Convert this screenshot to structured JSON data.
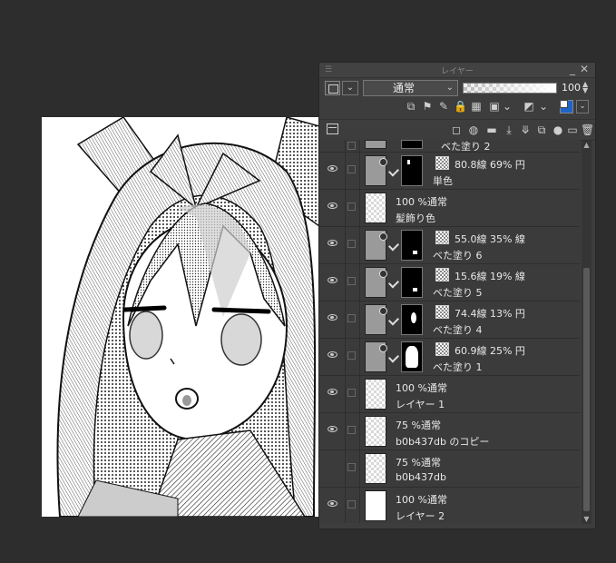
{
  "panel": {
    "title": "レイヤー",
    "blend_mode": "通常",
    "opacity": "100",
    "blend_arrow": "⌄"
  },
  "layers": [
    {
      "name": "ベた塗り 2",
      "info": "",
      "visible": false,
      "type": "partial"
    },
    {
      "name": "単色",
      "info": "80.8線 69% 円",
      "visible": true,
      "type": "tone",
      "mask_shape": "small"
    },
    {
      "name": "髪飾り色",
      "info": "100 %通常",
      "visible": true,
      "type": "raster"
    },
    {
      "name": "ベた塗り 6",
      "info": "55.0線 35% 線",
      "visible": true,
      "type": "tone",
      "mask_shape": "dot"
    },
    {
      "name": "ベた塗り 5",
      "info": "15.6線 19% 線",
      "visible": true,
      "type": "tone",
      "mask_shape": "dot"
    },
    {
      "name": "ベた塗り 4",
      "info": "74.4線 13% 円",
      "visible": true,
      "type": "tone",
      "mask_shape": "blob"
    },
    {
      "name": "ベた塗り 1",
      "info": "60.9線 25% 円",
      "visible": true,
      "type": "tone",
      "mask_shape": "hair"
    },
    {
      "name": "レイヤー 1",
      "info": "100 %通常",
      "visible": true,
      "type": "raster"
    },
    {
      "name": "b0b437db のコピー",
      "info": "75 %通常",
      "visible": true,
      "type": "raster"
    },
    {
      "name": "b0b437db",
      "info": "75 %通常",
      "visible": false,
      "type": "raster"
    },
    {
      "name": "レイヤー 2",
      "info": "100 %通常",
      "visible": true,
      "type": "white"
    }
  ],
  "icons": {
    "panel_menu": "grip-icon",
    "minimize": "minimize-icon",
    "close": "close-icon"
  }
}
